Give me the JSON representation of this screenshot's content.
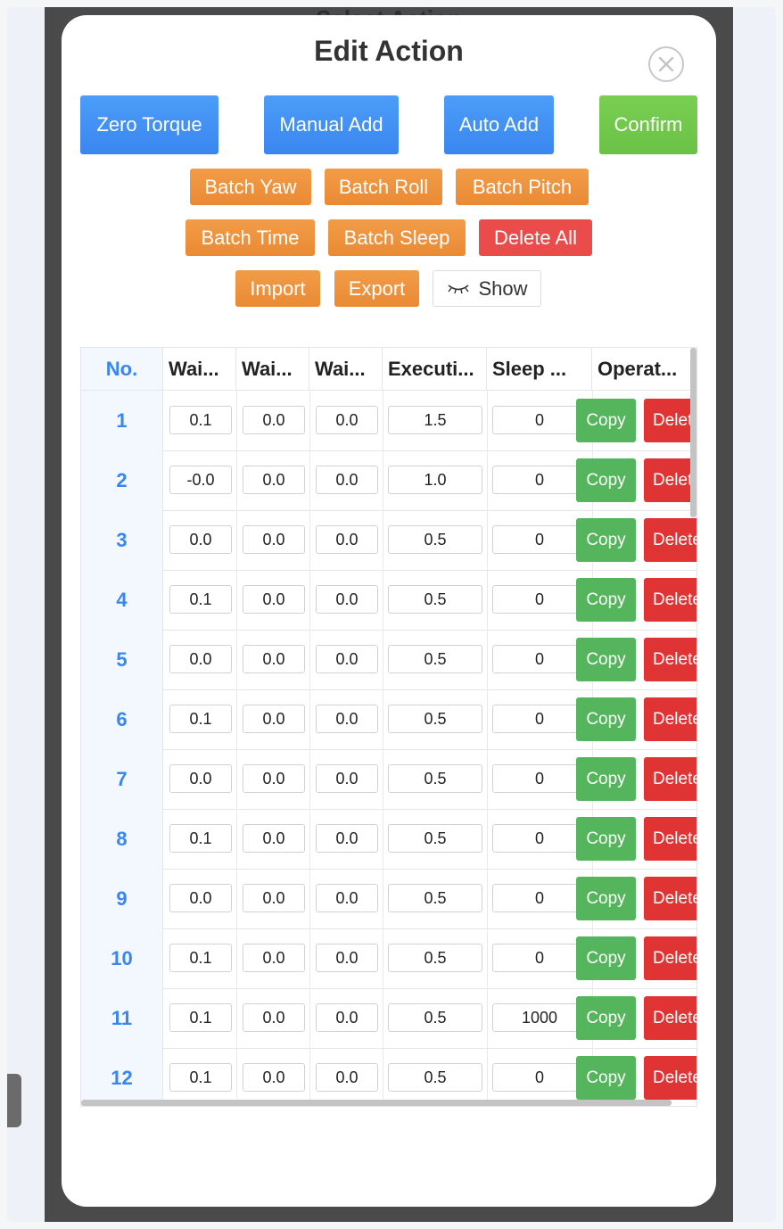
{
  "background": {
    "title": "Select Action"
  },
  "modal": {
    "title": "Edit Action",
    "close_icon": "close-circle-icon"
  },
  "toolbar": {
    "zero_torque": "Zero Torque",
    "manual_add": "Manual Add",
    "auto_add": "Auto Add",
    "confirm": "Confirm",
    "batch_yaw": "Batch Yaw",
    "batch_roll": "Batch Roll",
    "batch_pitch": "Batch Pitch",
    "batch_time": "Batch Time",
    "batch_sleep": "Batch Sleep",
    "delete_all": "Delete All",
    "import": "Import",
    "export": "Export",
    "show": "Show",
    "show_icon": "eye-closed-icon"
  },
  "table": {
    "headers": [
      "No.",
      "Wai...",
      "Wai...",
      "Wai...",
      "Executi...",
      "Sleep ...",
      "Operat..."
    ],
    "copy_label": "Copy",
    "delete_label": "Delete",
    "rows": [
      {
        "no": "1",
        "w1": "0.1",
        "w2": "0.0",
        "w3": "0.0",
        "exec": "1.5",
        "sleep": "0"
      },
      {
        "no": "2",
        "w1": "-0.0",
        "w2": "0.0",
        "w3": "0.0",
        "exec": "1.0",
        "sleep": "0"
      },
      {
        "no": "3",
        "w1": "0.0",
        "w2": "0.0",
        "w3": "0.0",
        "exec": "0.5",
        "sleep": "0"
      },
      {
        "no": "4",
        "w1": "0.1",
        "w2": "0.0",
        "w3": "0.0",
        "exec": "0.5",
        "sleep": "0"
      },
      {
        "no": "5",
        "w1": "0.0",
        "w2": "0.0",
        "w3": "0.0",
        "exec": "0.5",
        "sleep": "0"
      },
      {
        "no": "6",
        "w1": "0.1",
        "w2": "0.0",
        "w3": "0.0",
        "exec": "0.5",
        "sleep": "0"
      },
      {
        "no": "7",
        "w1": "0.0",
        "w2": "0.0",
        "w3": "0.0",
        "exec": "0.5",
        "sleep": "0"
      },
      {
        "no": "8",
        "w1": "0.1",
        "w2": "0.0",
        "w3": "0.0",
        "exec": "0.5",
        "sleep": "0"
      },
      {
        "no": "9",
        "w1": "0.0",
        "w2": "0.0",
        "w3": "0.0",
        "exec": "0.5",
        "sleep": "0"
      },
      {
        "no": "10",
        "w1": "0.1",
        "w2": "0.0",
        "w3": "0.0",
        "exec": "0.5",
        "sleep": "0"
      },
      {
        "no": "11",
        "w1": "0.1",
        "w2": "0.0",
        "w3": "0.0",
        "exec": "0.5",
        "sleep": "1000"
      },
      {
        "no": "12",
        "w1": "0.1",
        "w2": "0.0",
        "w3": "0.0",
        "exec": "0.5",
        "sleep": "0"
      }
    ]
  }
}
